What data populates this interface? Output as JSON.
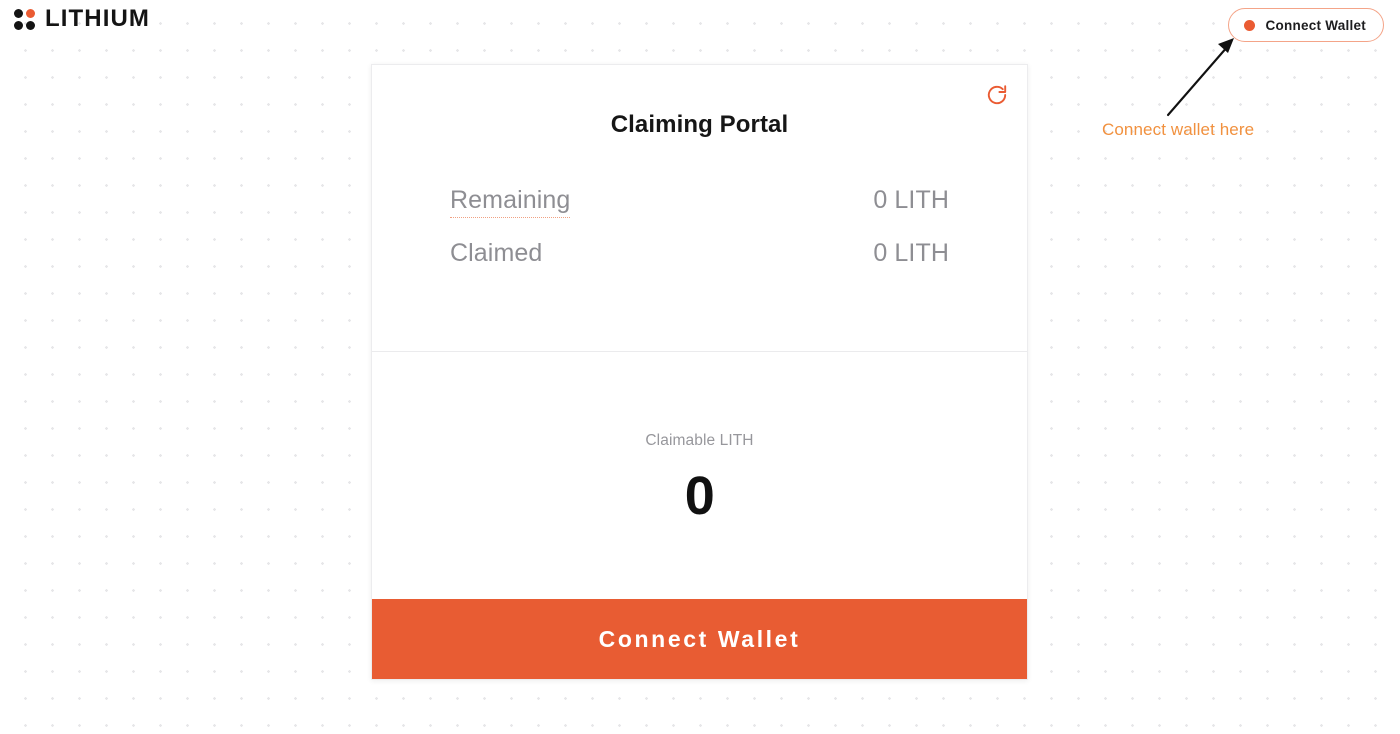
{
  "header": {
    "brand_name": "LITHIUM",
    "logo_icon": "four-dot-grid-icon",
    "wallet_button_label": "Connect Wallet",
    "wallet_status_icon": "status-dot-icon"
  },
  "annotation": {
    "text": "Connect wallet here",
    "arrow_icon": "arrow-up-right-icon",
    "text_color": "#f1913f"
  },
  "card": {
    "title": "Claiming Portal",
    "refresh_icon": "refresh-icon",
    "stats": [
      {
        "label": "Remaining",
        "value": "0 LITH",
        "has_tooltip_underline": true
      },
      {
        "label": "Claimed",
        "value": "0 LITH",
        "has_tooltip_underline": false
      }
    ],
    "claimable": {
      "label": "Claimable LITH",
      "amount": "0"
    },
    "cta_label": "Connect Wallet"
  },
  "colors": {
    "accent": "#e85c33",
    "accent_soft": "#f4a488",
    "annotation": "#f1913f",
    "muted_text": "#8e8e93",
    "background": "#ffffff",
    "dot_grid": "#e7e7e9"
  }
}
